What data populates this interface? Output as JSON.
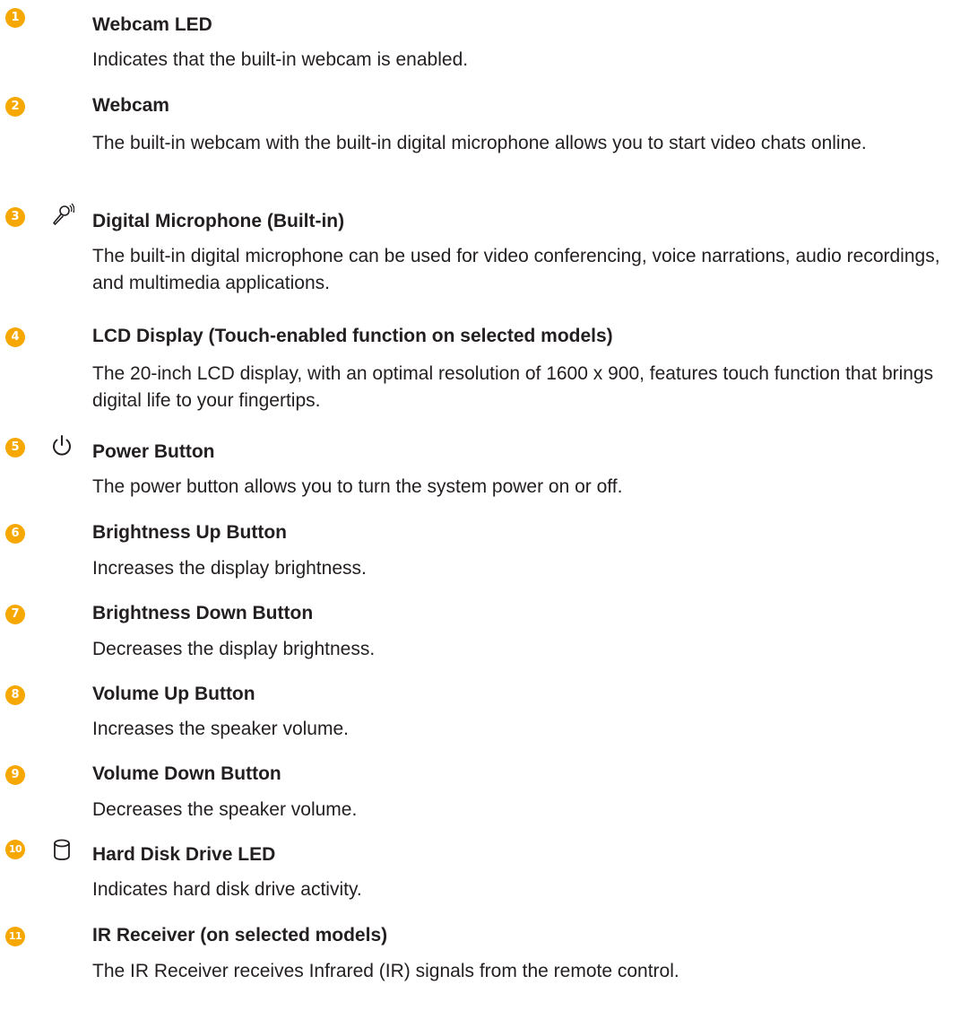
{
  "accent_color": "#f6a800",
  "items": [
    {
      "number": "1",
      "title": "Webcam LED",
      "icon": null,
      "description": "Indicates that the built-in webcam is enabled."
    },
    {
      "number": "2",
      "title": "Webcam",
      "icon": null,
      "description": "The built-in webcam with the built-in digital microphone allows you to start video chats online."
    },
    {
      "number": "3",
      "title": "Digital Microphone (Built-in)",
      "icon": "microphone-icon",
      "description": "The built-in digital microphone can be used for video conferencing, voice narrations, audio recordings, and multimedia applications."
    },
    {
      "number": "4",
      "title": "LCD Display (Touch-enabled function on selected models)",
      "icon": null,
      "description": "The 20-inch LCD display, with an optimal resolution of 1600 x 900, features touch function that brings digital life to your fingertips."
    },
    {
      "number": "5",
      "title": "Power Button",
      "icon": "power-icon",
      "description": "The power button allows you to turn the system power on or off."
    },
    {
      "number": "6",
      "title": "Brightness Up Button",
      "icon": null,
      "description": "Increases the display brightness."
    },
    {
      "number": "7",
      "title": "Brightness Down Button",
      "icon": null,
      "description": "Decreases the display brightness."
    },
    {
      "number": "8",
      "title": "Volume Up Button",
      "icon": null,
      "description": "Increases the speaker volume."
    },
    {
      "number": "9",
      "title": "Volume Down Button",
      "icon": null,
      "description": "Decreases the speaker volume."
    },
    {
      "number": "10",
      "title": "Hard Disk Drive LED",
      "icon": "hard-disk-icon",
      "description": "Indicates hard disk drive activity."
    },
    {
      "number": "11",
      "title": "IR Receiver (on selected models)",
      "icon": null,
      "description": "The IR Receiver receives Infrared (IR) signals from the remote control."
    }
  ]
}
